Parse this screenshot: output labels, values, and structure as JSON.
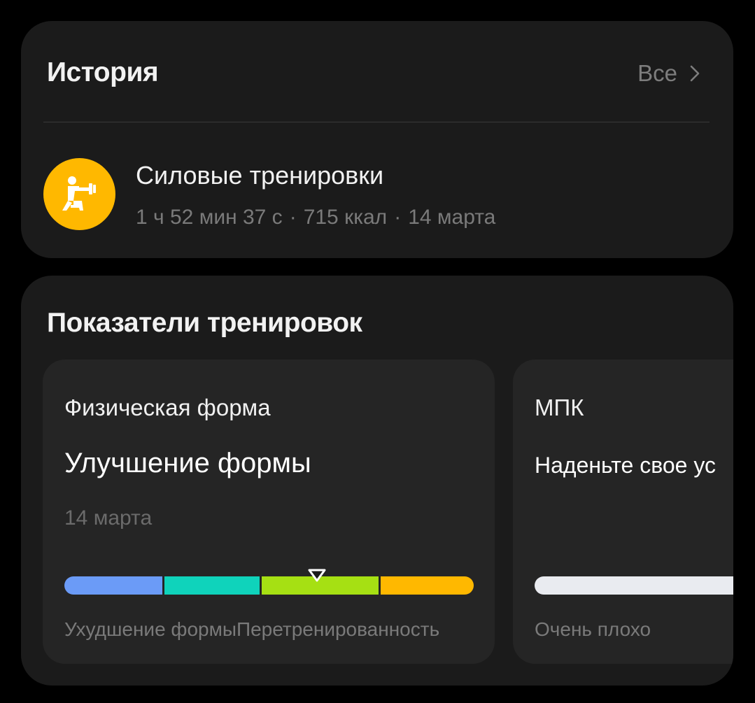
{
  "history": {
    "title": "История",
    "see_all": "Все",
    "workout": {
      "icon": "strength-training-icon",
      "icon_color": "#ffb800",
      "name": "Силовые тренировки",
      "duration": "1 ч 52 мин 37 с",
      "calories": "715 ккал",
      "date": "14 марта",
      "separator": "·"
    }
  },
  "metrics": {
    "title": "Показатели тренировок",
    "fitness": {
      "title": "Физическая форма",
      "status": "Улучшение формы",
      "date": "14 марта",
      "segments": [
        {
          "color": "#6b9bf7"
        },
        {
          "color": "#0fd3bb"
        },
        {
          "color": "#a6e013"
        },
        {
          "color": "#ffb800"
        }
      ],
      "marker_position": 0.617,
      "labels": "Ухудшение формыПеретренированность"
    },
    "vo2": {
      "title": "МПК",
      "status": "Наденьте свое ус",
      "bar_color": "#e9ebf0",
      "label": "Очень плохо"
    }
  }
}
